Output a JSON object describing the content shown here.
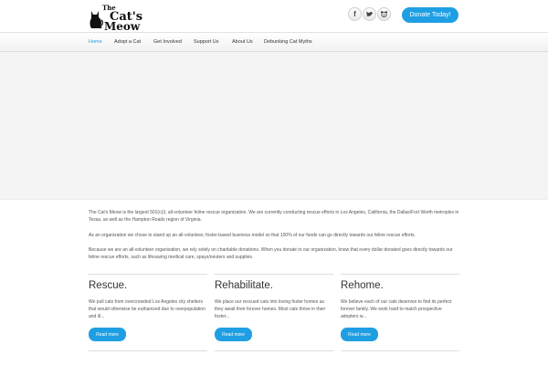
{
  "brand": {
    "logo_line1": "The",
    "logo_line2": "Cat's",
    "logo_line3": "Meow"
  },
  "social": {
    "facebook_glyph": "f",
    "twitter_icon": "twitter-bird-icon",
    "third_icon": "dog-face-icon"
  },
  "header": {
    "donate_label": "Donate Today!"
  },
  "nav": {
    "items": [
      {
        "label": "Home"
      },
      {
        "label": "Adopt a Cat"
      },
      {
        "label": "Get Involved"
      },
      {
        "label": "Support Us"
      },
      {
        "label": "About Us"
      },
      {
        "label": "Debunking Cat Myths"
      }
    ]
  },
  "intro": {
    "paragraphs": [
      "The Cat's Meow is the largest 501(c)3, all-volunteer feline rescue organization. We are currently conducting rescue efforts in Los Angeles, California, the Dallas/Fort Worth metroplex in Texas, as well as the Hampton Roads region of Virginia.",
      "As an organization we chose to stand up an all-volunteer, foster-based business model so that 100% of our funds can go directly towards our feline rescue efforts.",
      "Because we are an all-volunteer organization, we rely solely on charitable donations. When you donate to our organization, know that every dollar donated goes directly towards our feline rescue efforts, such as lifesaving medical care, spays/neuters and supplies."
    ]
  },
  "columns": [
    {
      "title": "Rescue.",
      "text": "We pull cats from overcrowded Los Angeles city shelters that would otherwise be euthanized due to overpopulation and ill...",
      "button": "Read more"
    },
    {
      "title": "Rehabilitate.",
      "text": "We place our rescued cats into loving foster homes as they await their forever homes. Most cats thrive in their foster...",
      "button": "Read more"
    },
    {
      "title": "Rehome.",
      "text": "We believe each of our cats deserves to find its perfect forever family. We work hard to match prospective adopters w...",
      "button": "Read more"
    }
  ],
  "colors": {
    "accent": "#1f9fe3",
    "hero_bg": "#f4f4f4"
  }
}
